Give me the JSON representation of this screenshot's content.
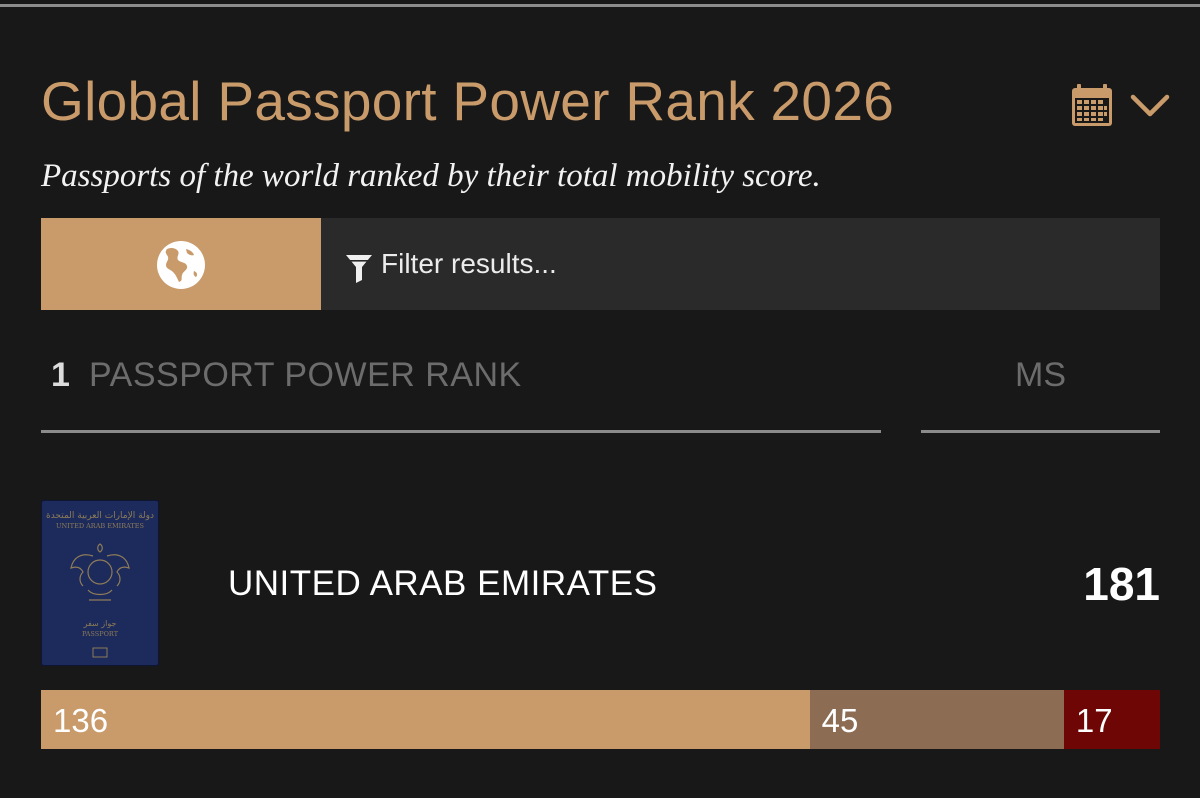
{
  "header": {
    "title": "Global Passport Power Rank 2026",
    "subtitle": "Passports of the world ranked by their total mobility score."
  },
  "icons": {
    "calendar": "calendar-icon",
    "chevron": "chevron-down-icon",
    "globe": "globe-icon",
    "filter": "filter-icon"
  },
  "filter": {
    "placeholder": "Filter results...",
    "value": ""
  },
  "table": {
    "rank_number": "1",
    "rank_header": "PASSPORT POWER RANK",
    "score_header": "MS",
    "rows": [
      {
        "country": "UNITED ARAB EMIRATES",
        "score": "181",
        "passport_cover_text": [
          "دولة الإمارات العربية المتحدة",
          "UNITED ARAB EMIRATES",
          "جواز سفر",
          "PASSPORT"
        ],
        "breakdown": [
          {
            "label": "136",
            "value": 136,
            "color": "#c99a6a"
          },
          {
            "label": "45",
            "value": 45,
            "color": "#8c6d54"
          },
          {
            "label": "17",
            "value": 17,
            "color": "#6e0606"
          }
        ]
      }
    ]
  },
  "colors": {
    "accent": "#c99a6a",
    "background": "#181818",
    "panel": "#2a2a2a",
    "passport": "#1c2a5c"
  }
}
